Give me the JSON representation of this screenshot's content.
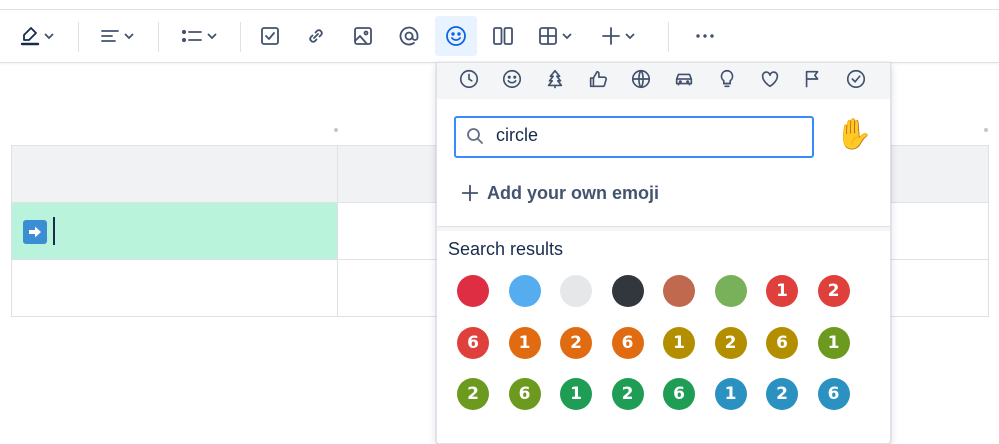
{
  "toolbar": {
    "items": [
      {
        "name": "text-color-button",
        "icon": "highlighter-icon"
      },
      {
        "name": "align-button",
        "icon": "align-left-icon"
      },
      {
        "name": "list-button",
        "icon": "bullet-list-icon"
      },
      {
        "name": "action-item-button",
        "icon": "checkbox-icon"
      },
      {
        "name": "link-button",
        "icon": "link-icon"
      },
      {
        "name": "image-button",
        "icon": "image-icon"
      },
      {
        "name": "mention-button",
        "icon": "at-icon"
      },
      {
        "name": "emoji-button",
        "icon": "smiley-icon",
        "active": true
      },
      {
        "name": "layouts-button",
        "icon": "columns-icon"
      },
      {
        "name": "table-button",
        "icon": "table-icon"
      },
      {
        "name": "insert-button",
        "icon": "plus-icon"
      },
      {
        "name": "more-button",
        "icon": "more-icon"
      }
    ]
  },
  "editor": {
    "selected_cell_emoji": "arrow-right-icon",
    "selected_cell_color": "#baf3db"
  },
  "picker": {
    "categories": [
      "clock-icon",
      "smiley-icon",
      "tree-icon",
      "thumbs-up-icon",
      "ball-icon",
      "car-icon",
      "bulb-icon",
      "heart-icon",
      "flag-icon",
      "check-circle-icon"
    ],
    "search_value": "circle",
    "skin_tone": "✋",
    "add_label": "Add your own emoji",
    "results_title": "Search results",
    "results": [
      {
        "label": "",
        "color": "#dd2e44"
      },
      {
        "label": "",
        "color": "#55acee"
      },
      {
        "label": "",
        "color": "#e6e7e8"
      },
      {
        "label": "",
        "color": "#31373d"
      },
      {
        "label": "",
        "color": "#c1694f"
      },
      {
        "label": "",
        "color": "#78b159"
      },
      {
        "label": "1",
        "color": "#e0403b"
      },
      {
        "label": "2",
        "color": "#e0403b"
      },
      {
        "label": "6",
        "color": "#e0403b"
      },
      {
        "label": "1",
        "color": "#e06b10"
      },
      {
        "label": "2",
        "color": "#e06b10"
      },
      {
        "label": "6",
        "color": "#e06b10"
      },
      {
        "label": "1",
        "color": "#b38f00"
      },
      {
        "label": "2",
        "color": "#b38f00"
      },
      {
        "label": "6",
        "color": "#b38f00"
      },
      {
        "label": "1",
        "color": "#6c9a1e"
      },
      {
        "label": "2",
        "color": "#6c9a1e"
      },
      {
        "label": "6",
        "color": "#6c9a1e"
      },
      {
        "label": "1",
        "color": "#1f9d55"
      },
      {
        "label": "2",
        "color": "#1f9d55"
      },
      {
        "label": "6",
        "color": "#1f9d55"
      },
      {
        "label": "1",
        "color": "#2a91c0"
      },
      {
        "label": "2",
        "color": "#2a91c0"
      },
      {
        "label": "6",
        "color": "#2a91c0"
      }
    ]
  }
}
